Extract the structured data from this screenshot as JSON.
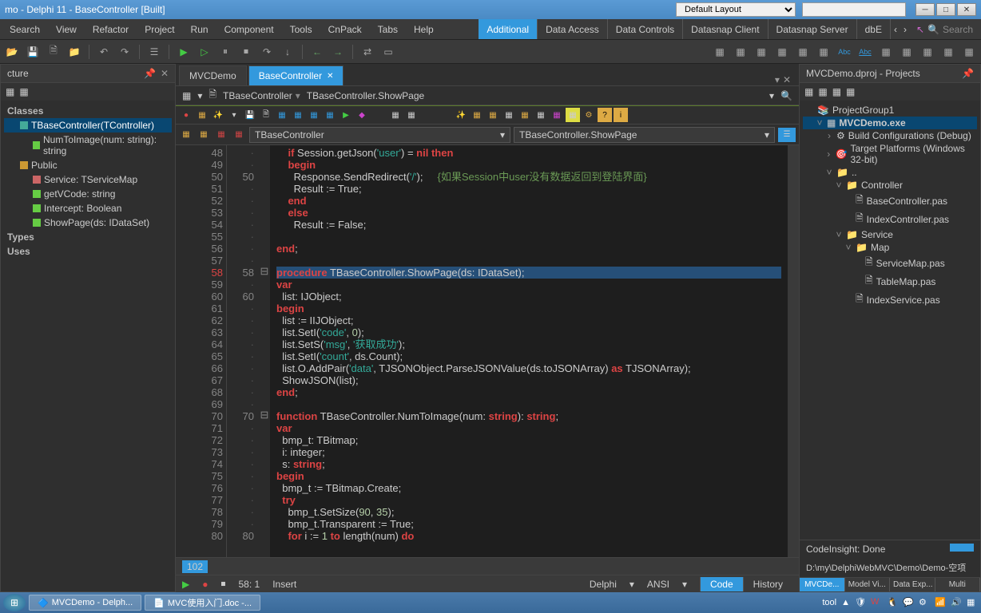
{
  "window": {
    "title": "mo - Delphi 11 - BaseController [Built]"
  },
  "layout_combo": "Default Layout",
  "menubar": [
    "Search",
    "View",
    "Refactor",
    "Project",
    "Run",
    "Component",
    "Tools",
    "CnPack",
    "Tabs",
    "Help"
  ],
  "menu_tabs": [
    "Additional",
    "Data Access",
    "Data Controls",
    "Datasnap Client",
    "Datasnap Server",
    "dbE"
  ],
  "menu_active_tab": "Additional",
  "search_placeholder": "Search",
  "structure": {
    "title": "cture",
    "sections": {
      "classes": "Classes",
      "types": "Types",
      "uses": "Uses"
    },
    "class_name": "TBaseController(TController)",
    "members": [
      "NumToImage(num: string): string",
      "Public",
      "Service: TServiceMap",
      "getVCode: string",
      "Intercept: Boolean",
      "ShowPage(ds: IDataSet)"
    ]
  },
  "editor_tabs": [
    "MVCDemo",
    "BaseController"
  ],
  "active_tab": "BaseController",
  "breadcrumb": {
    "class": "TBaseController",
    "method": "TBaseController.ShowPage"
  },
  "nav_combo1": "TBaseController",
  "nav_combo2": "TBaseController.ShowPage",
  "gutter_start": 48,
  "gutter_secondary": {
    "50": "50",
    "58": "58",
    "60": "60",
    "70": "70",
    "80": "80"
  },
  "code_lines": [
    {
      "n": 48,
      "html": "    <span class='kw'>if</span> Session.getJson(<span class='str'>'user'</span>) = <span class='kw'>nil then</span>"
    },
    {
      "n": 49,
      "html": "    <span class='kw'>begin</span>"
    },
    {
      "n": 50,
      "html": "      Response.SendRedirect(<span class='str'>'/'</span>);     <span class='cmt'>{如果Session中user没有数据返回到登陆界面}</span>"
    },
    {
      "n": 51,
      "html": "      Result := True;"
    },
    {
      "n": 52,
      "html": "    <span class='kw'>end</span>"
    },
    {
      "n": 53,
      "html": "    <span class='kw'>else</span>"
    },
    {
      "n": 54,
      "html": "      Result := False;"
    },
    {
      "n": 55,
      "html": ""
    },
    {
      "n": 56,
      "html": "<span class='kw'>end</span>;"
    },
    {
      "n": 57,
      "html": ""
    },
    {
      "n": 58,
      "html": "<span class='kw'>procedure</span> TBaseController.ShowPage(ds: IDataSet);",
      "hl": true
    },
    {
      "n": 59,
      "html": "<span class='kw'>var</span>"
    },
    {
      "n": 60,
      "html": "  list: IJObject;"
    },
    {
      "n": 61,
      "html": "<span class='kw'>begin</span>"
    },
    {
      "n": 62,
      "html": "  list := IIJObject;"
    },
    {
      "n": 63,
      "html": "  list.SetI(<span class='str'>'code'</span>, <span class='num'>0</span>);"
    },
    {
      "n": 64,
      "html": "  list.SetS(<span class='str'>'msg'</span>, <span class='str'>'获取成功'</span>);"
    },
    {
      "n": 65,
      "html": "  list.SetI(<span class='str'>'count'</span>, ds.Count);"
    },
    {
      "n": 66,
      "html": "  list.O.AddPair(<span class='str'>'data'</span>, TJSONObject.ParseJSONValue(ds.toJSONArray) <span class='kw'>as</span> TJSONArray);"
    },
    {
      "n": 67,
      "html": "  ShowJSON(list);"
    },
    {
      "n": 68,
      "html": "<span class='kw'>end</span>;"
    },
    {
      "n": 69,
      "html": ""
    },
    {
      "n": 70,
      "html": "<span class='kw'>function</span> TBaseController.NumToImage(num: <span class='kw'>string</span>): <span class='kw'>string</span>;"
    },
    {
      "n": 71,
      "html": "<span class='kw'>var</span>"
    },
    {
      "n": 72,
      "html": "  bmp_t: TBitmap;"
    },
    {
      "n": 73,
      "html": "  i: integer;"
    },
    {
      "n": 74,
      "html": "  s: <span class='kw'>string</span>;"
    },
    {
      "n": 75,
      "html": "<span class='kw'>begin</span>"
    },
    {
      "n": 76,
      "html": "  bmp_t := TBitmap.Create;"
    },
    {
      "n": 77,
      "html": "  <span class='kw'>try</span>"
    },
    {
      "n": 78,
      "html": "    bmp_t.SetSize(<span class='num'>90</span>, <span class='num'>35</span>);"
    },
    {
      "n": 79,
      "html": "    bmp_t.Transparent := True;"
    },
    {
      "n": 80,
      "html": "    <span class='kw'>for</span> i := <span class='num'>1</span> <span class='kw'>to</span> length(num) <span class='kw'>do</span>"
    }
  ],
  "line_total": "102",
  "status": {
    "pos": "58: 1",
    "mode": "Insert",
    "lang": "Delphi",
    "enc": "ANSI"
  },
  "status_tabs": [
    "Code",
    "History"
  ],
  "projects": {
    "title": "MVCDemo.dproj - Projects",
    "root": "ProjectGroup1",
    "exe": "MVCDemo.exe",
    "build_cfg": "Build Configurations (Debug)",
    "target": "Target Platforms (Windows 32-bit)",
    "folders": {
      "root": "..",
      "controller": "Controller",
      "service": "Service",
      "map": "Map"
    },
    "files": {
      "base": "BaseController.pas",
      "index": "IndexController.pas",
      "svcmap": "ServiceMap.pas",
      "tblmap": "TableMap.pas",
      "idxsvc": "IndexService.pas"
    }
  },
  "codeinsight": "CodeInsight: Done",
  "project_path": "D:\\my\\DelphiWebMVC\\Demo\\Demo-空项",
  "right_tabs": [
    "MVCDe...",
    "Model Vi...",
    "Data Exp...",
    "Multi"
  ],
  "taskbar": {
    "items": [
      "MVCDemo - Delph...",
      "MVC使用入门.doc -..."
    ],
    "tray_text": "tool"
  }
}
